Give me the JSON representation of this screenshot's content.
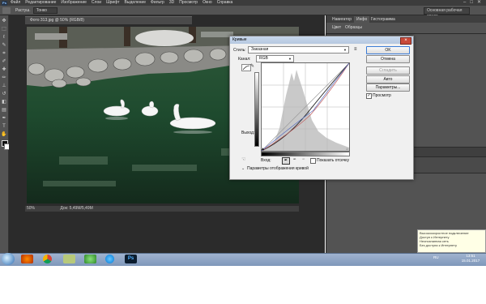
{
  "menubar": {
    "app_badge": "Ps",
    "items": [
      "Файл",
      "Редактирование",
      "Изображение",
      "Слои",
      "Шрифт",
      "Выделение",
      "Фильтр",
      "3D",
      "Просмотр",
      "Окно",
      "Справка"
    ],
    "window_controls": [
      "–",
      "□",
      "✕"
    ]
  },
  "optbar": {
    "edge_label": "Растуш.",
    "edge_value": "Тонко",
    "workspace": "Основная рабочая среда"
  },
  "document": {
    "tab_title": "Фото 313.jpg @ 50% (RGB/8)",
    "zoom": "50%",
    "doc_info": "Док: 5,49M/5,49M"
  },
  "panels": {
    "top_tabs": [
      "Навигатор",
      "Инфо",
      "Гистограмма"
    ],
    "second_tabs": [
      "Цвет",
      "Образцы"
    ]
  },
  "curves": {
    "title": "Кривые",
    "preset_label": "Стиль:",
    "preset_value": "Заказная",
    "channel_label": "Канал:",
    "channel_value": "RGB",
    "output_label": "Выход:",
    "input_label": "Вход:",
    "show_clipping_label": "Показать отсечку",
    "curve_options_label": "Параметры отображения кривой",
    "buttons": {
      "ok": "OK",
      "cancel": "Отмена",
      "smooth": "Сгладить",
      "auto": "Авто",
      "options": "Параметры...",
      "preview": "Просмотр"
    },
    "preview_checked": true
  },
  "notification": {
    "line1": "Высокоскоростное подключение",
    "line2": "Доступ к Интернету",
    "line3": "Неопознанная сеть",
    "line4": "Без доступа к Интернету"
  },
  "taskbar": {
    "lang": "RU",
    "time": "13:51",
    "date": "15.01.2017",
    "ps_label": "Ps"
  },
  "colors": {
    "chrome_dark": "#3c3c3c",
    "panel_gray": "#535353",
    "dialog_bg": "#f0f0f0",
    "taskbar_blue": "#8aa1c4"
  }
}
